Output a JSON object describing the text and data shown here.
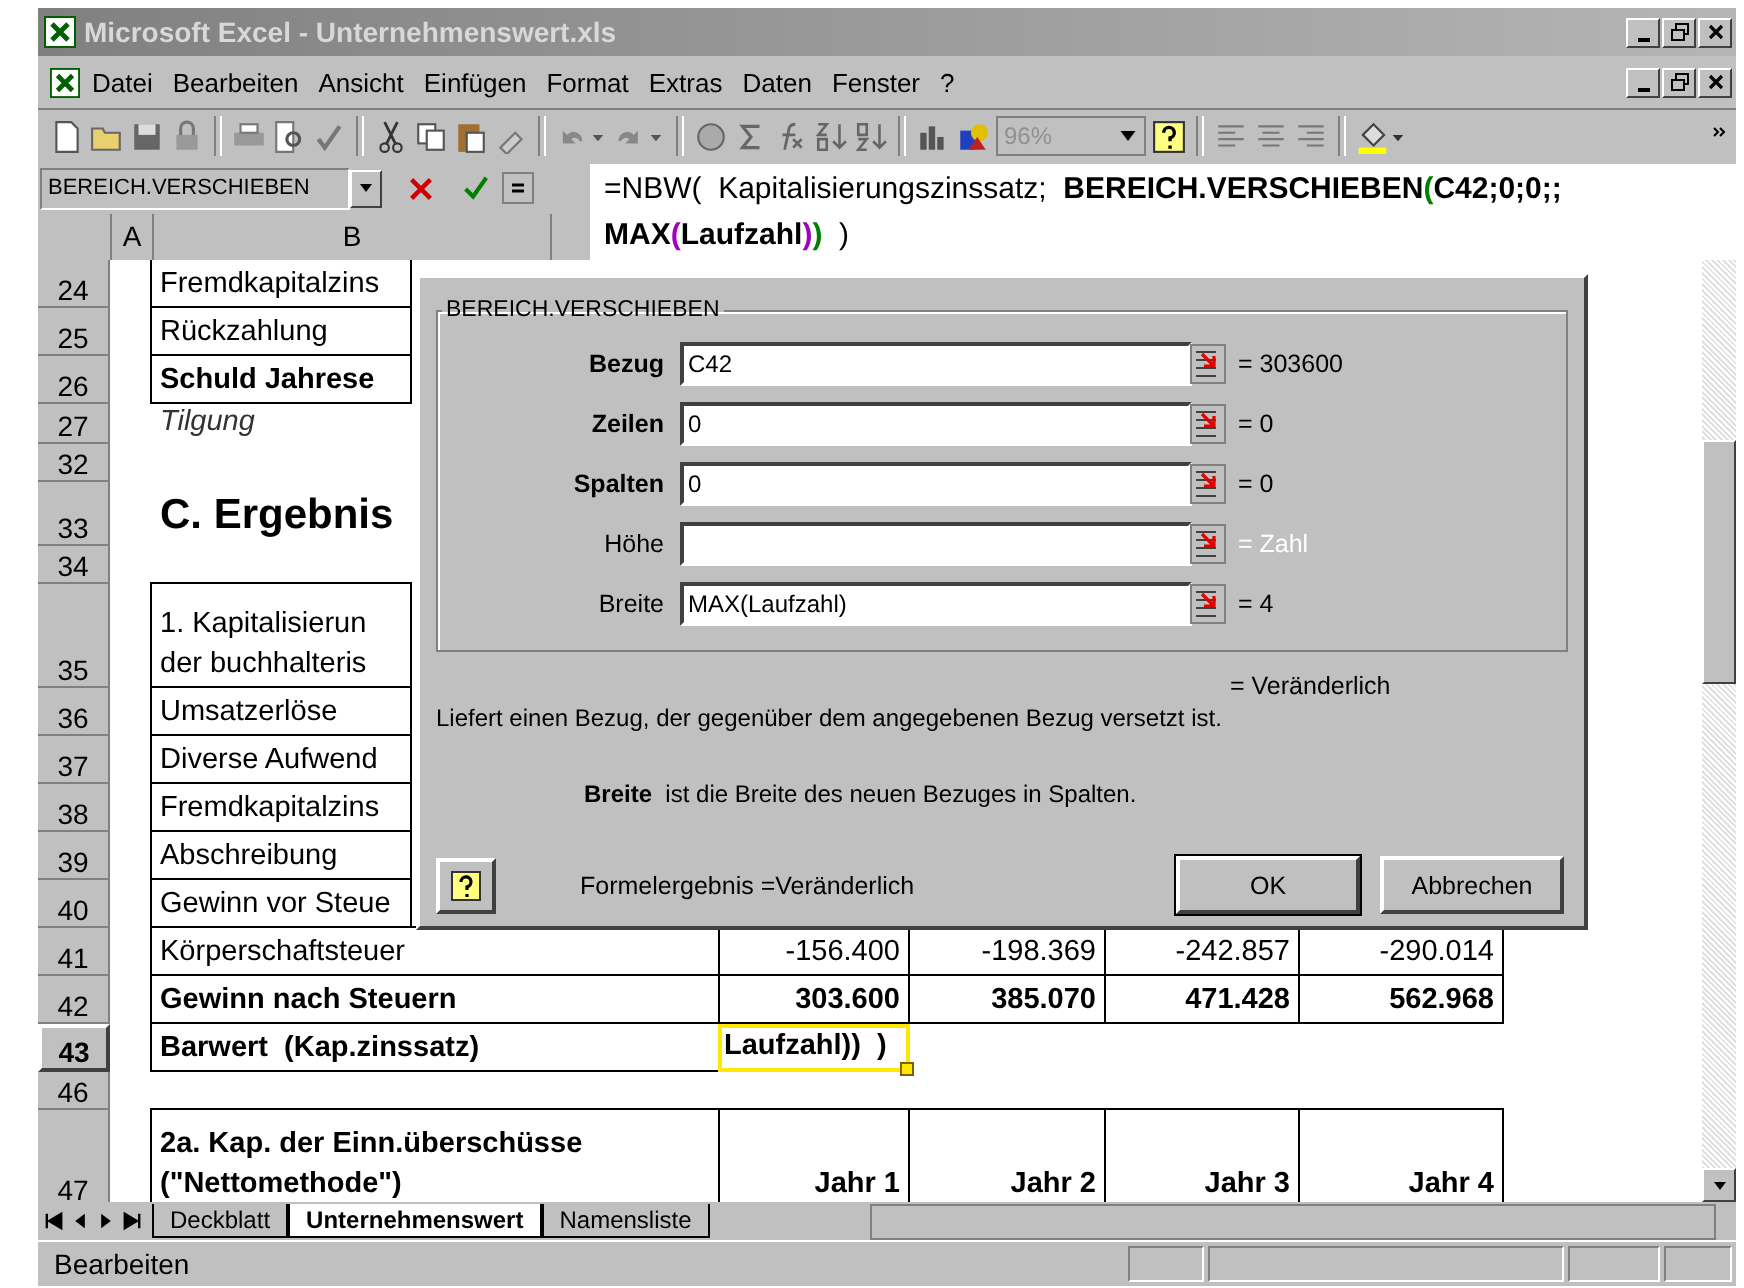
{
  "window": {
    "title": "Microsoft Excel - Unternehmenswert.xls"
  },
  "menu": [
    "Datei",
    "Bearbeiten",
    "Ansicht",
    "Einfügen",
    "Format",
    "Extras",
    "Daten",
    "Fenster",
    "?"
  ],
  "toolbar": {
    "zoom": "96%"
  },
  "name_box": "BEREICH.VERSCHIEBEN",
  "formula": {
    "lines": [
      [
        {
          "text": "=NBW(  Kapitalisierungszinssatz;  ",
          "kind": "plain"
        },
        {
          "text": "BEREICH.VERSCHIEBEN",
          "kind": "bold"
        },
        {
          "text": "(",
          "kind": "green"
        },
        {
          "text": "C42;0;0;;",
          "kind": "bold"
        }
      ],
      [
        {
          "text": "MAX",
          "kind": "bold"
        },
        {
          "text": "(",
          "kind": "purple"
        },
        {
          "text": "Laufzahl",
          "kind": "bold"
        },
        {
          "text": ")",
          "kind": "purple"
        },
        {
          "text": ")",
          "kind": "green"
        },
        {
          "text": "  )",
          "kind": "plain"
        }
      ]
    ]
  },
  "columns": [
    "A",
    "B"
  ],
  "rows": [
    {
      "header": "24",
      "kind": "plain",
      "boxed": true,
      "cells": [
        "Fremdkapitalzins"
      ]
    },
    {
      "header": "25",
      "kind": "plain",
      "boxed": true,
      "cells": [
        "Rückzahlung"
      ]
    },
    {
      "header": "26",
      "kind": "bold",
      "boxed": true,
      "cells": [
        "Schuld Jahrese"
      ]
    },
    {
      "header": "27",
      "kind": "italic",
      "boxed": false,
      "cells": [
        "Tilgung"
      ]
    },
    {
      "header": "32",
      "kind": "gap",
      "cells": []
    },
    {
      "header": "33",
      "kind": "heading",
      "boxed": false,
      "cells": [
        "C. Ergebnis"
      ]
    },
    {
      "header": "34",
      "kind": "gap",
      "cells": []
    },
    {
      "header": "35",
      "kind": "double",
      "boxed": true,
      "cells": [
        "1. Kapitalisierun\nder buchhalteris"
      ]
    },
    {
      "header": "36",
      "kind": "plain",
      "boxed": true,
      "cells": [
        "Umsatzerlöse"
      ]
    },
    {
      "header": "37",
      "kind": "plain",
      "boxed": true,
      "cells": [
        "Diverse Aufwend"
      ]
    },
    {
      "header": "38",
      "kind": "plain",
      "boxed": true,
      "cells": [
        "Fremdkapitalzins"
      ]
    },
    {
      "header": "39",
      "kind": "plain",
      "boxed": true,
      "cells": [
        "Abschreibung"
      ]
    },
    {
      "header": "40",
      "kind": "plain",
      "boxed": true,
      "cells": [
        "Gewinn vor Steue"
      ]
    },
    {
      "header": "41",
      "kind": "plain",
      "boxed": true,
      "cells": [
        "Körperschaftsteuer",
        "-156.400",
        "-198.369",
        "-242.857",
        "-290.014"
      ]
    },
    {
      "header": "42",
      "kind": "bold",
      "boxed": true,
      "cells": [
        "Gewinn nach Steuern",
        "303.600",
        "385.070",
        "471.428",
        "562.968"
      ]
    },
    {
      "header": "43",
      "kind": "bold",
      "boxed": true,
      "cells": [
        "Barwert  (Kap.zinssatz)"
      ],
      "edit_text": "Laufzahl))  )"
    },
    {
      "header": "46",
      "kind": "gap",
      "cells": []
    },
    {
      "header": "47",
      "kind": "doublebold",
      "boxed": true,
      "cells": [
        "2a. Kap. der Einn.überschüsse\n(\"Nettomethode\")",
        "Jahr 1",
        "Jahr 2",
        "Jahr 3",
        "Jahr 4"
      ]
    }
  ],
  "dialog": {
    "group_title": "BEREICH.VERSCHIEBEN",
    "arguments": [
      {
        "label": "Bezug",
        "required": true,
        "value": "C42",
        "result": "= 303600",
        "muted": false
      },
      {
        "label": "Zeilen",
        "required": true,
        "value": "0",
        "result": "= 0",
        "muted": false
      },
      {
        "label": "Spalten",
        "required": true,
        "value": "0",
        "result": "= 0",
        "muted": false
      },
      {
        "label": "Höhe",
        "required": false,
        "result": "= Zahl",
        "muted": true
      },
      {
        "label": "Breite",
        "required": false,
        "value": "MAX(Laufzahl)",
        "result": "= 4",
        "muted": false
      }
    ],
    "overall_result": "= Veränderlich",
    "description": "Liefert einen Bezug, der gegenüber dem angegebenen Bezug versetzt ist.",
    "argument_help": "**Breite**  ist die Breite des neuen Bezuges in Spalten.",
    "formula_result": "Formelergebnis =Veränderlich",
    "buttons": [
      {
        "label": "OK",
        "default": true
      },
      {
        "label": "Abbrechen",
        "default": false
      }
    ]
  },
  "sheet_tabs": [
    {
      "label": "Deckblatt",
      "selected": false
    },
    {
      "label": "Unternehmenswert",
      "selected": true
    },
    {
      "label": "Namensliste",
      "selected": false
    }
  ],
  "status_bar": {
    "text": "Bearbeiten"
  }
}
